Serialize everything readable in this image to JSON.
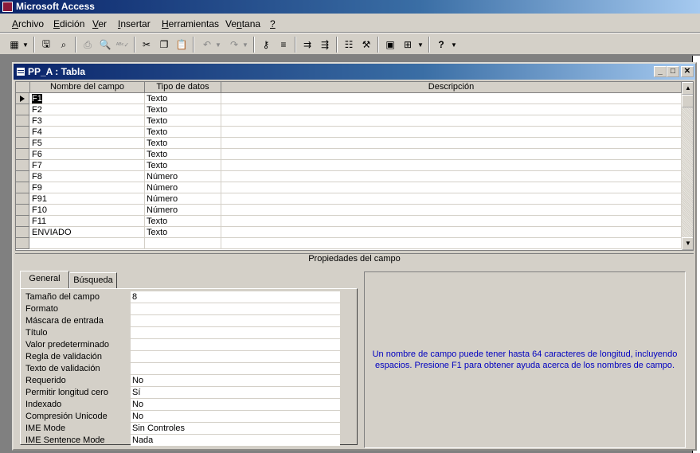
{
  "app": {
    "title": "Microsoft Access"
  },
  "menubar": [
    {
      "label": "Archivo",
      "u": "A",
      "rest": "rchivo"
    },
    {
      "label": "Edición",
      "u": "E",
      "rest": "dición"
    },
    {
      "label": "Ver",
      "u": "V",
      "rest": "er"
    },
    {
      "label": "Insertar",
      "u": "I",
      "rest": "nsertar"
    },
    {
      "label": "Herramientas",
      "u": "H",
      "rest": "erramientas"
    },
    {
      "label": "Ventana",
      "pre": "Ve",
      "u": "n",
      "rest": "tana"
    },
    {
      "label": "?",
      "u": "?",
      "rest": ""
    }
  ],
  "toolbar": {
    "icons": [
      "view-icon",
      "save-icon",
      "search-file-icon",
      "print-icon",
      "print-preview-icon",
      "spelling-icon",
      "cut-icon",
      "copy-icon",
      "paste-icon",
      "undo-icon",
      "redo-icon",
      "primary-key-icon",
      "build-icon",
      "insert-rows-icon",
      "delete-rows-icon",
      "properties-icon",
      "build-wand-icon",
      "database-window-icon",
      "new-object-icon",
      "help-icon"
    ]
  },
  "window": {
    "title": "PP_A : Tabla",
    "grid": {
      "headers": [
        "Nombre del campo",
        "Tipo de datos",
        "Descripción"
      ],
      "rows": [
        {
          "name": "F1",
          "type": "Texto",
          "desc": ""
        },
        {
          "name": "F2",
          "type": "Texto",
          "desc": ""
        },
        {
          "name": "F3",
          "type": "Texto",
          "desc": ""
        },
        {
          "name": "F4",
          "type": "Texto",
          "desc": ""
        },
        {
          "name": "F5",
          "type": "Texto",
          "desc": ""
        },
        {
          "name": "F6",
          "type": "Texto",
          "desc": ""
        },
        {
          "name": "F7",
          "type": "Texto",
          "desc": ""
        },
        {
          "name": "F8",
          "type": "Número",
          "desc": ""
        },
        {
          "name": "F9",
          "type": "Número",
          "desc": ""
        },
        {
          "name": "F91",
          "type": "Número",
          "desc": ""
        },
        {
          "name": "F10",
          "type": "Número",
          "desc": ""
        },
        {
          "name": "F11",
          "type": "Texto",
          "desc": ""
        },
        {
          "name": "ENVIADO",
          "type": "Texto",
          "desc": ""
        },
        {
          "name": "",
          "type": "",
          "desc": ""
        }
      ]
    },
    "props_label": "Propiedades del campo",
    "tabs": [
      "General",
      "Búsqueda"
    ],
    "properties": [
      {
        "label": "Tamaño del campo",
        "value": "8"
      },
      {
        "label": "Formato",
        "value": ""
      },
      {
        "label": "Máscara de entrada",
        "value": ""
      },
      {
        "label": "Título",
        "value": ""
      },
      {
        "label": "Valor predeterminado",
        "value": ""
      },
      {
        "label": "Regla de validación",
        "value": ""
      },
      {
        "label": "Texto de validación",
        "value": ""
      },
      {
        "label": "Requerido",
        "value": "No"
      },
      {
        "label": "Permitir longitud cero",
        "value": "Sí"
      },
      {
        "label": "Indexado",
        "value": "No"
      },
      {
        "label": "Compresión Unicode",
        "value": "No"
      },
      {
        "label": "IME Mode",
        "value": "Sin Controles"
      },
      {
        "label": "IME Sentence Mode",
        "value": "Nada"
      }
    ],
    "help_text": "Un nombre de campo puede tener hasta 64 caracteres de longitud, incluyendo espacios. Presione F1 para obtener ayuda acerca de los nombres de campo."
  },
  "colors": {
    "titlebar": "#0a246a",
    "chrome": "#d4d0c8",
    "help_text": "#0000c0"
  }
}
